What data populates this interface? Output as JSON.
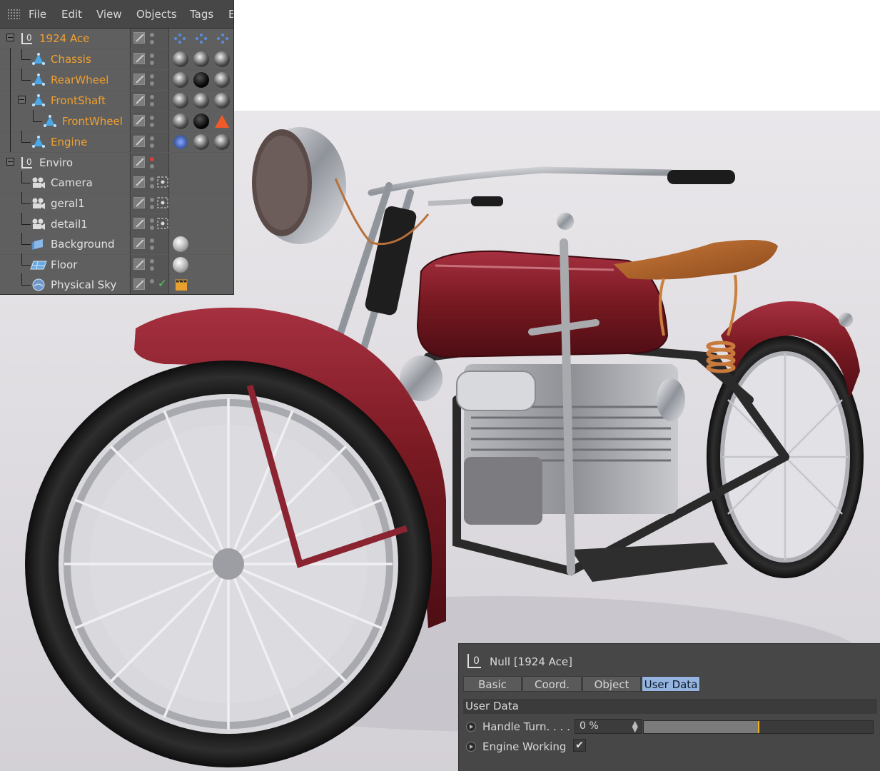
{
  "menu": {
    "items": [
      "File",
      "Edit",
      "View",
      "Objects",
      "Tags",
      "B"
    ]
  },
  "objects": {
    "rows": [
      {
        "label": "1924 Ace",
        "icon": "null-icon"
      },
      {
        "label": "Chassis",
        "icon": "polygon-object-icon"
      },
      {
        "label": "RearWheel",
        "icon": "polygon-object-icon"
      },
      {
        "label": "FrontShaft",
        "icon": "polygon-object-icon"
      },
      {
        "label": "FrontWheel",
        "icon": "polygon-object-icon"
      },
      {
        "label": "Engine",
        "icon": "polygon-object-icon"
      },
      {
        "label": "Enviro",
        "icon": "null-icon"
      },
      {
        "label": "Camera",
        "icon": "camera-icon"
      },
      {
        "label": "geral1",
        "icon": "camera-icon"
      },
      {
        "label": "detail1",
        "icon": "camera-icon"
      },
      {
        "label": "Background",
        "icon": "background-icon"
      },
      {
        "label": "Floor",
        "icon": "floor-icon"
      },
      {
        "label": "Physical Sky",
        "icon": "sky-icon"
      }
    ]
  },
  "attributes": {
    "title": "Null [1924 Ace]",
    "tabs": [
      "Basic",
      "Coord.",
      "Object",
      "User Data"
    ],
    "active_tab": "User Data",
    "section": "User Data",
    "handle_turn": {
      "label": "Handle Turn. . . .",
      "value": "0 %",
      "slider_fraction": 0.5
    },
    "engine_working": {
      "label": "Engine Working",
      "checked": true,
      "mark": "✔"
    }
  },
  "colors": {
    "selected_object_text": "#f0a030",
    "active_tab": "#95b4df",
    "slider_marker": "#f0b020",
    "bike_paint": "#7a1a22"
  }
}
